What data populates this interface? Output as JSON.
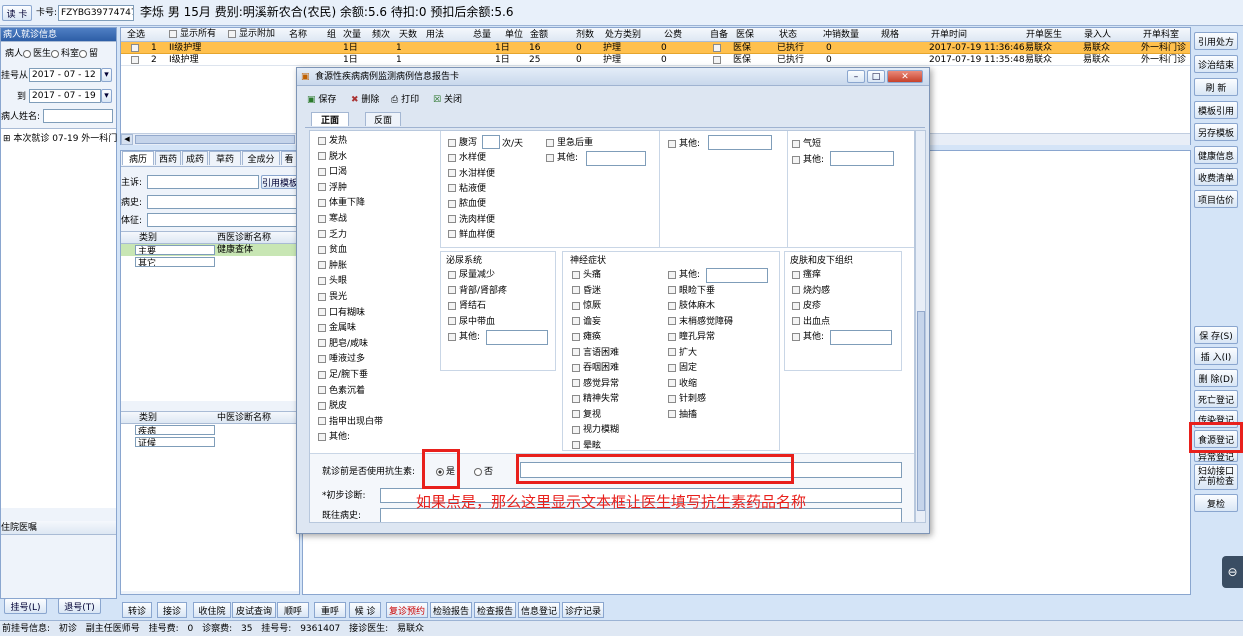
{
  "header": {
    "card_btn": "读 卡",
    "card_label": "卡号:",
    "card_no": "FZYBG39774747",
    "patient": "李烁 男 15月 费别:明溪新农合(农民) 余额:5.6 待扣:0 预扣后余额:5.6"
  },
  "left": {
    "title": "病人就诊信息",
    "radio_patient": "病人",
    "radio_doctor": "医生",
    "radio_dept": "科室",
    "radio_stay": "留",
    "reg_from_label": "挂号从",
    "reg_from": "2017 - 07 - 12",
    "reg_to_label": "到",
    "reg_to": "2017 - 07 - 19",
    "name_label": "病人姓名:",
    "visit_item": "本次就诊 07-19 外一科门",
    "hospital_order": "住院医嘱",
    "reg_btn": "挂号(L)",
    "unreg_btn": "退号(T)"
  },
  "orders": {
    "show_all": "显示所有",
    "show_extra": "显示附加",
    "headers": [
      "全选",
      "",
      "组",
      "次量",
      "频次",
      "天数",
      "用法",
      "总量",
      "单位",
      "金额",
      "剂数",
      "处方类别",
      "公费",
      "自备",
      "医保",
      "状态",
      "冲销数量",
      "规格",
      "开单时间",
      "开单医生",
      "录入人",
      "开单科室"
    ],
    "rows": [
      {
        "no": "1",
        "name": "II级护理",
        "dose": "1日",
        "freq": "1",
        "total": "1日",
        "price": "16",
        "days": "0",
        "type": "护理",
        "pub": "0",
        "ins": "医保",
        "status": "已执行",
        "cancel": "0",
        "time": "2017-07-19 11:36:46",
        "doc": "易联众",
        "entry": "易联众",
        "dept": "外一科门诊"
      },
      {
        "no": "2",
        "name": "I级护理",
        "dose": "1日",
        "freq": "1",
        "total": "1日",
        "price": "25",
        "days": "0",
        "type": "护理",
        "pub": "0",
        "ins": "医保",
        "status": "已执行",
        "cancel": "0",
        "time": "2017-07-19 11:35:48",
        "doc": "易联众",
        "entry": "易联众",
        "dept": "外一科门诊"
      }
    ],
    "name_header": "名称"
  },
  "record": {
    "tabs": [
      "病历",
      "西药",
      "成药",
      "草药",
      "全成分",
      "看"
    ],
    "complaint": "主诉:",
    "history": "病史:",
    "sign": "体征:",
    "cite_template": "引用模板",
    "cat_header": "类别",
    "west_diag_header": "西医诊断名称",
    "main_cat": "主要",
    "other_cat": "其它",
    "diag_value": "健康查体",
    "cn_diag_header": "中医诊断名称",
    "disease": "疾病",
    "syndrome": "证候"
  },
  "right_buttons": [
    "引用处方",
    "诊治结束",
    "刷 新",
    "模板引用",
    "另存模板",
    "健康信息",
    "收费清单",
    "项目估价",
    "保 存(S)",
    "插 入(I)",
    "删 除(D)",
    "死亡登记",
    "传染登记",
    "食源登记",
    "异常登记",
    "妇幼接口 产前检查",
    "复检"
  ],
  "bottom_tabs": [
    "转诊",
    "接诊",
    "收住院",
    "皮试查询",
    "顺呼",
    "重呼",
    "候 诊",
    "复诊预约",
    "检验报告",
    "检查报告",
    "信息登记",
    "诊疗记录"
  ],
  "status": {
    "text": "前挂号信息: 初诊 副主任医师号 挂号费: 0 诊察费: 35 挂号号: 9361407 接诊医生: 易联众"
  },
  "dialog": {
    "title": "食源性疾病病例监测病例信息报告卡",
    "save": "保存",
    "delete": "删除",
    "print": "打印",
    "close": "关闭",
    "tab_front": "正面",
    "tab_back": "反面",
    "col1": [
      "发热",
      "脱水",
      "口渴",
      "浮肿",
      "体重下降",
      "寒战",
      "乏力",
      "贫血",
      "肿胀",
      "头眼",
      "畏光",
      "口有糊味",
      "金属味",
      "肥皂/咸味",
      "唾液过多",
      "足/腕下垂",
      "色素沉着",
      "脱皮",
      "指甲出现白带",
      "其他:"
    ],
    "col2": [
      "腹泻",
      "水样便",
      "水泔样便",
      "粘液便",
      "脓血便",
      "洗肉样便",
      "鲜血样便"
    ],
    "diarrhea_unit": "次/天",
    "col3": [
      "里急后重",
      "其他:"
    ],
    "other": "其他:",
    "short_breath": "气短",
    "urinary_title": "泌尿系统",
    "urinary": [
      "尿量减少",
      "背部/肾部疼",
      "肾结石",
      "尿中带血",
      "其他:"
    ],
    "neuro_title": "神经症状",
    "neuro1": [
      "头痛",
      "昏迷",
      "惊厥",
      "谵妄",
      "瘫痪",
      "言语困难",
      "吞咽困难",
      "感觉异常",
      "精神失常",
      "复视",
      "视力模糊",
      "晕眩"
    ],
    "neuro2": [
      "其他:",
      "眼睑下垂",
      "肢体麻木",
      "末梢感觉障碍",
      "瞳孔异常",
      "扩大",
      "固定",
      "收缩",
      "针刺感",
      "抽搐"
    ],
    "skin_title": "皮肤和皮下组织",
    "skin": [
      "瘙痒",
      "烧灼感",
      "皮疹",
      "出血点",
      "其他:"
    ],
    "antibiotic_label": "就诊前是否使用抗生素:",
    "yes": "是",
    "no": "否",
    "initial_diag": "*初步诊断:",
    "past_history": "既往病史:",
    "annotation": "如果点是，那么这里显示文本框让医生填写抗生素药品名称"
  },
  "colors": {
    "accent": "#e8201c",
    "selected_row": "#ffc04d"
  }
}
